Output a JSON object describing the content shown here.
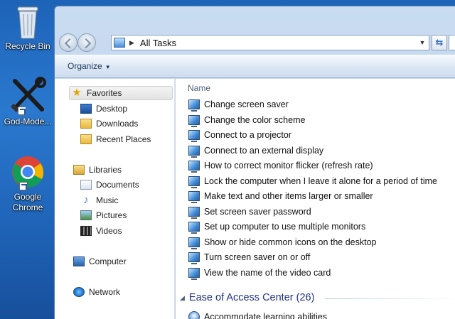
{
  "desktop": {
    "icons": [
      {
        "label": "Recycle Bin"
      },
      {
        "label": "God-Mode..."
      },
      {
        "label": "Google Chrome"
      }
    ]
  },
  "window": {
    "address": {
      "path": "All Tasks",
      "separator": "▶"
    },
    "toolbar": {
      "organize_label": "Organize",
      "caret": "▼"
    },
    "nav": {
      "favorites": {
        "label": "Favorites",
        "items": [
          "Desktop",
          "Downloads",
          "Recent Places"
        ]
      },
      "libraries": {
        "label": "Libraries",
        "items": [
          "Documents",
          "Music",
          "Pictures",
          "Videos"
        ]
      },
      "computer": "Computer",
      "network": "Network"
    },
    "content": {
      "column_header": "Name",
      "tasks": [
        "Change screen saver",
        "Change the color scheme",
        "Connect to a projector",
        "Connect to an external display",
        "How to correct monitor flicker (refresh rate)",
        "Lock the computer when I leave it alone for a period of time",
        "Make text and other items larger or smaller",
        "Set screen saver password",
        "Set up computer to use multiple monitors",
        "Show or hide common icons on the desktop",
        "Turn screen saver on or off",
        "View the name of the video card"
      ],
      "group": {
        "collapse_glyph": "◢",
        "title": "Ease of Access Center (26)"
      },
      "group_tasks": [
        "Accommodate learning abilities"
      ]
    }
  },
  "icons": {
    "recycle_bin": "recycle-bin-icon",
    "god_mode": "tools-icon",
    "chrome": "chrome-icon",
    "task": "display-settings-icon",
    "ease": "ease-of-access-icon"
  }
}
